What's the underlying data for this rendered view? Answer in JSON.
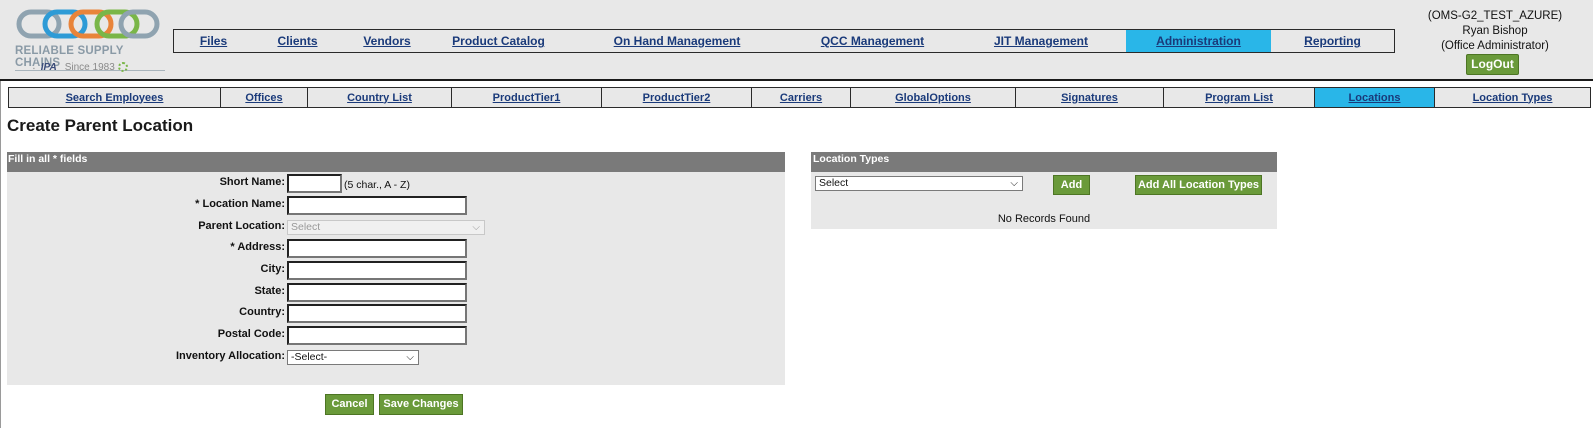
{
  "logo": {
    "name": "RELIABLE SUPPLY CHAINS",
    "partner": "IPA",
    "since": "Since 1983"
  },
  "main_nav": [
    {
      "label": "Files",
      "active": false
    },
    {
      "label": "Clients",
      "active": false
    },
    {
      "label": "Vendors",
      "active": false
    },
    {
      "label": "Product Catalog",
      "active": false
    },
    {
      "label": "On Hand Management",
      "active": false
    },
    {
      "label": "QCC Management",
      "active": false
    },
    {
      "label": "JIT Management",
      "active": false
    },
    {
      "label": "Administration",
      "active": true
    },
    {
      "label": "Reporting",
      "active": false
    }
  ],
  "user": {
    "env": "(OMS-G2_TEST_AZURE)",
    "name": "Ryan Bishop",
    "role": "(Office Administrator)",
    "logout_label": "LogOut"
  },
  "sub_nav": [
    {
      "label": "Search Employees",
      "active": false
    },
    {
      "label": "Offices",
      "active": false
    },
    {
      "label": "Country List",
      "active": false
    },
    {
      "label": "ProductTier1",
      "active": false
    },
    {
      "label": "ProductTier2",
      "active": false
    },
    {
      "label": "Carriers",
      "active": false
    },
    {
      "label": "GlobalOptions",
      "active": false
    },
    {
      "label": "Signatures",
      "active": false
    },
    {
      "label": "Program List",
      "active": false
    },
    {
      "label": "Locations",
      "active": true
    },
    {
      "label": "Location Types",
      "active": false
    }
  ],
  "page_title": "Create Parent Location",
  "form": {
    "header": "Fill in all * fields",
    "short_name_label": "Short Name:",
    "short_name_value": "",
    "short_name_hint": "(5 char., A - Z)",
    "location_name_label": "* Location Name:",
    "location_name_value": "",
    "parent_location_label": "Parent Location:",
    "parent_location_value": "Select",
    "address_label": "* Address:",
    "address_value": "",
    "city_label": "City:",
    "city_value": "",
    "state_label": "State:",
    "state_value": "",
    "country_label": "Country:",
    "country_value": "",
    "postal_code_label": "Postal Code:",
    "postal_code_value": "",
    "inventory_allocation_label": "Inventory Allocation:",
    "inventory_allocation_value": "-Select-",
    "cancel_label": "Cancel",
    "save_label": "Save Changes"
  },
  "location_types": {
    "header": "Location Types",
    "select_value": "Select",
    "add_label": "Add",
    "add_all_label": "Add All Location Types",
    "empty_text": "No Records Found"
  },
  "colors": {
    "active_tab": "#29b6e8",
    "button_green": "#6a9a3a",
    "panel_header": "#7a7a7a",
    "panel_bg": "#e8e8e8",
    "link": "#1a3a7a"
  }
}
